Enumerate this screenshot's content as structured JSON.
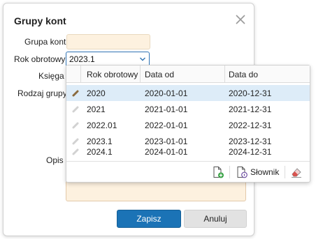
{
  "dialog": {
    "title": "Grupy kont",
    "labels": {
      "grupa_kont": "Grupa kont",
      "rok_obrotowy": "Rok obrotowy",
      "ksiega": "Księga",
      "rodzaj_grupy": "Rodzaj grupy",
      "opis": "Opis"
    },
    "grupa_kont_value": "",
    "rok_obrotowy_value": "2023.1",
    "opis_value": "",
    "buttons": {
      "save": "Zapisz",
      "cancel": "Anuluj"
    }
  },
  "dropdown": {
    "columns": [
      "Rok obrotowy",
      "Data od",
      "Data do"
    ],
    "rows": [
      {
        "rok": "2020",
        "od": "2020-01-01",
        "do": "2020-12-31",
        "selected": true
      },
      {
        "rok": "2021",
        "od": "2021-01-01",
        "do": "2021-12-31",
        "selected": false
      },
      {
        "rok": "2022.01",
        "od": "2022-01-01",
        "do": "2022-12-31",
        "selected": false
      },
      {
        "rok": "2023.1",
        "od": "2023-01-01",
        "do": "2023-12-31",
        "selected": false
      },
      {
        "rok": "2024.1",
        "od": "2024-01-01",
        "do": "2024-12-31",
        "selected": false
      }
    ],
    "footer": {
      "slownik_label": "Słownik"
    }
  },
  "colors": {
    "accent": "#1b73b6",
    "selected_row": "#ddecf8",
    "required_field": "#fdf1df",
    "add_icon": "#3aa346",
    "eraser_icon": "#d9534f"
  }
}
